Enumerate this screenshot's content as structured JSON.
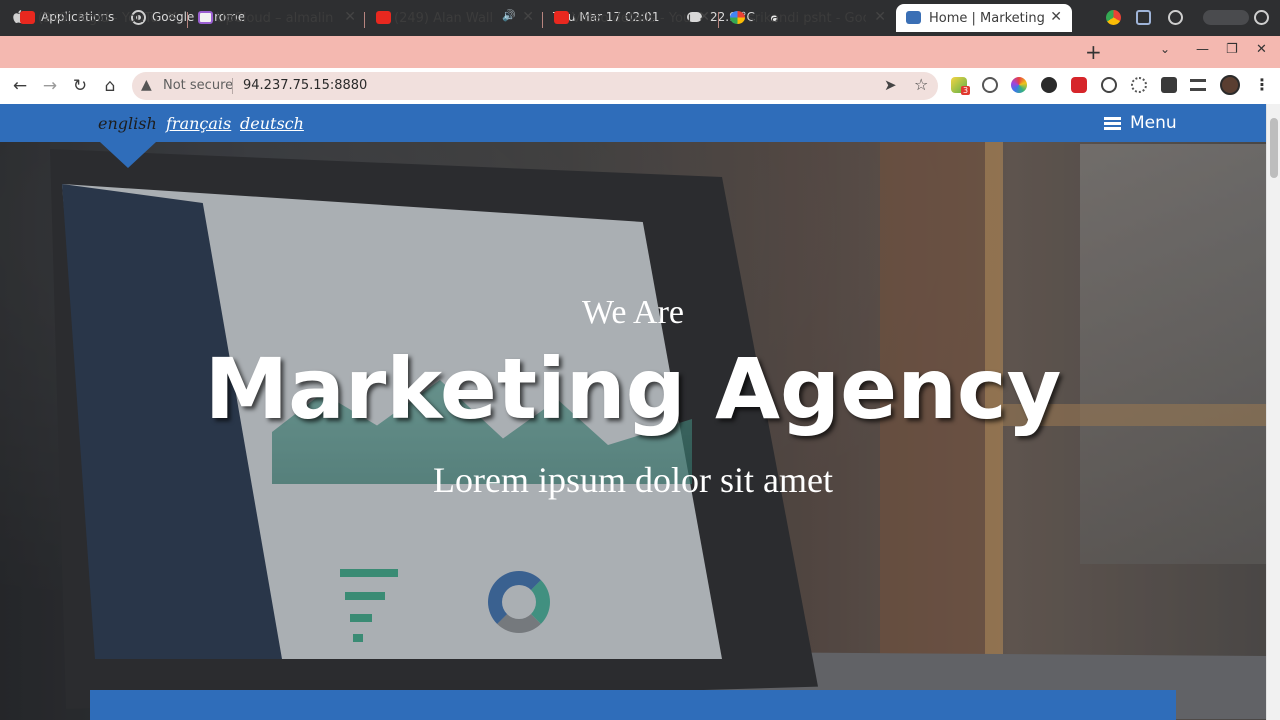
{
  "os": {
    "apps_label": "Applications",
    "chrome_label": "Google Chrome",
    "clock": "Thu Mar 17  02:01",
    "temperature": "22.9 °C"
  },
  "tabs": [
    {
      "label": "(249) fcgid - YouTu",
      "favicon": "youtube-icon",
      "color": "#e8281f"
    },
    {
      "label": "UpCloud – almalin",
      "favicon": "upcloud-icon",
      "color": "#9a5fd1"
    },
    {
      "label": "(249) Alan Wall",
      "favicon": "youtube-icon",
      "color": "#e8281f",
      "audio": "🔊"
    },
    {
      "label": "Video details - You",
      "favicon": "youtube-icon",
      "color": "#e8281f"
    },
    {
      "label": "srikandi psht - Goo",
      "favicon": "google-icon",
      "color": "#4a86e8"
    },
    {
      "label": "Home | Marketing",
      "favicon": "site-icon",
      "color": "#3a6fb5",
      "active": true
    }
  ],
  "tab_close": "✕",
  "new_tab": "+",
  "window": {
    "tab_search": "⌄",
    "minimize": "—",
    "restore": "❐",
    "close": "✕"
  },
  "toolbar": {
    "back": "←",
    "forward": "→",
    "reload": "↻",
    "home": "⌂",
    "security_icon": "▲",
    "not_secure": "Not secure",
    "url": "94.237.75.15:8880",
    "send_icon": "➤",
    "star_icon": "☆",
    "extension_badge": "3",
    "menu_icon": "⋮"
  },
  "site": {
    "languages": [
      {
        "label": "english",
        "active": true
      },
      {
        "label": "français",
        "active": false
      },
      {
        "label": "deutsch",
        "active": false
      }
    ],
    "menu_label": "Menu",
    "hero": {
      "pre_title": "We Are",
      "title": "Marketing Agency",
      "subtitle": "Lorem ipsum dolor sit amet"
    },
    "brand_color": "#2f6dba"
  }
}
